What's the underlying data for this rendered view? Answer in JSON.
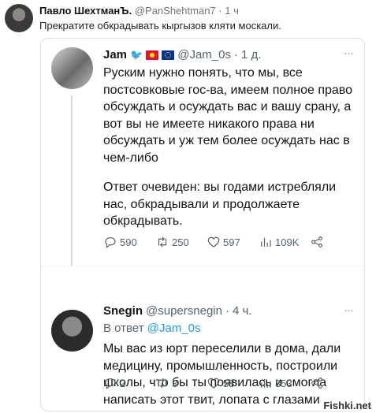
{
  "outer_post": {
    "author_name": "Павло ШехтманЪ.",
    "handle": "@PanShehtman7",
    "time": "1 ч",
    "text": "Прекратите обкрадывать кыргызов кляти москали."
  },
  "tweet1": {
    "author_name": "Jam",
    "handle": "@Jam_0s",
    "time": "1 д.",
    "text_part1": "Руским нужно понять, что мы, все постсовковые гос-ва, имеем полное право обсуждать и осуждать вас и вашу срану, а вот вы не имеете никакого права ни обсуждать и уж тем более осуждать нас в чем-либо",
    "text_part2": "Ответ очевиден: вы годами истребляли нас, обкрадывали и продолжаете обкрадывать.",
    "replies": "590",
    "retweets": "250",
    "likes": "597",
    "views": "109K"
  },
  "tweet2": {
    "author_name": "Snegin",
    "handle": "@supersnegin",
    "time": "4 ч.",
    "reply_prefix": "В ответ",
    "reply_mention": "@Jam_0s",
    "text": "Мы вас из юрт переселили в дома, дали медицину, промышленность, построили школы, что бы ты появилась и смогла написать этот твит, лопата с глазами",
    "replies": "2",
    "retweets": "3",
    "likes": "58",
    "views": "353"
  },
  "watermark": "Fishki.net",
  "colors": {
    "accent": "#1d9bf0",
    "muted": "#536471"
  },
  "icons": [
    "reply-icon",
    "retweet-icon",
    "like-icon",
    "views-icon",
    "share-icon",
    "bird-icon",
    "more-icon"
  ]
}
